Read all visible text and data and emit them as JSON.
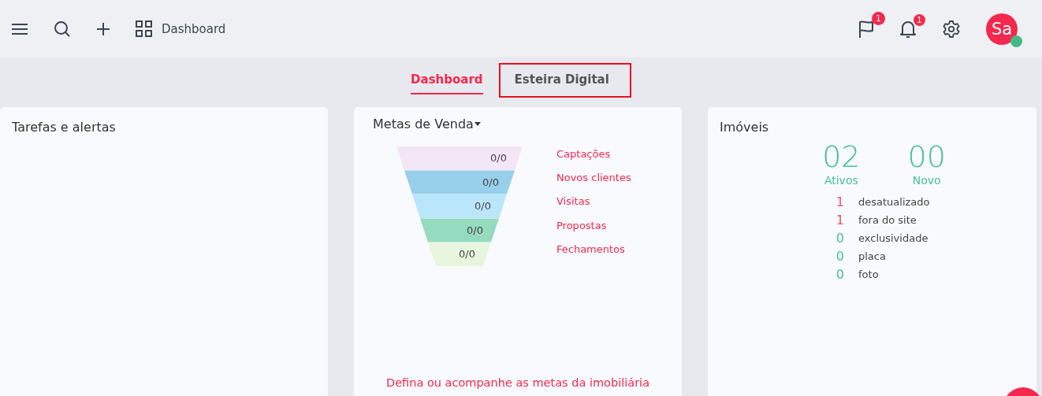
{
  "topbar": {
    "breadcrumb": "Dashboard",
    "flag_badge": "1",
    "bell_badge": "1",
    "avatar": "Sa",
    "online": true
  },
  "tabs": [
    {
      "label": "Dashboard",
      "selected": true,
      "highlighted": false
    },
    {
      "label": "Esteira Digital",
      "selected": false,
      "highlighted": true
    }
  ],
  "tasks": {
    "title": "Tarefas e alertas"
  },
  "sales_goals": {
    "title": "Metas de Venda",
    "stages": [
      {
        "value": "0/0",
        "label": "Captações",
        "color": "#f3e6f6"
      },
      {
        "value": "0/0",
        "label": "Novos clientes",
        "color": "#98cfea"
      },
      {
        "value": "0/0",
        "label": "Visitas",
        "color": "#bae6fb"
      },
      {
        "value": "0/0",
        "label": "Propostas",
        "color": "#95dbbf"
      },
      {
        "value": "0/0",
        "label": "Fechamentos",
        "color": "#e9f6de"
      }
    ],
    "footer_link": "Defina ou acompanhe as metas da imobiliária"
  },
  "properties": {
    "title": "Imóveis",
    "totals": [
      {
        "value": "02",
        "label": "Ativos"
      },
      {
        "value": "00",
        "label": "Novo"
      }
    ],
    "stats": [
      {
        "count": "1",
        "label": "desatualizado",
        "alert": true
      },
      {
        "count": "1",
        "label": "fora do site",
        "alert": true
      },
      {
        "count": "0",
        "label": "exclusividade",
        "alert": false
      },
      {
        "count": "0",
        "label": "placa",
        "alert": false
      },
      {
        "count": "0",
        "label": "foto",
        "alert": false
      }
    ]
  }
}
